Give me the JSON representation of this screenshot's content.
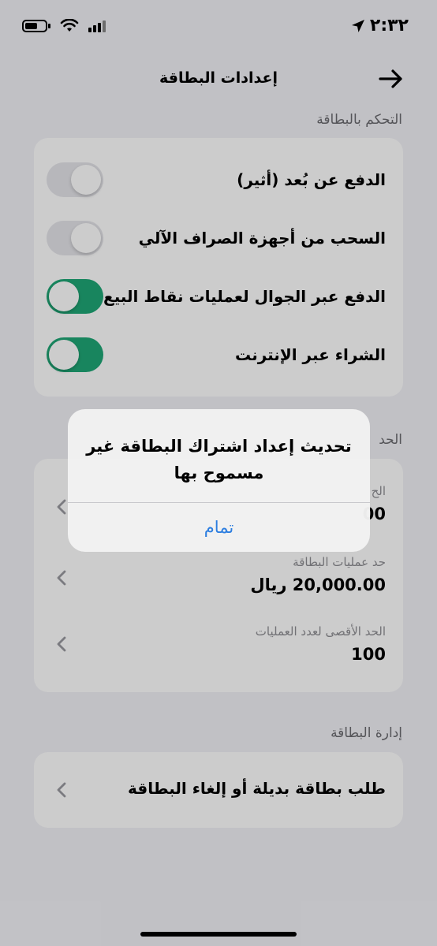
{
  "status_bar": {
    "time": "٢:٣٢"
  },
  "header": {
    "title": "إعدادات البطاقة"
  },
  "card_control": {
    "section_title": "التحكم بالبطاقة",
    "items": [
      {
        "label": "الدفع عن بُعد (أثير)",
        "enabled": false
      },
      {
        "label": "السحب من أجهزة الصراف الآلي",
        "enabled": false
      },
      {
        "label": "الدفع عبر الجوال لعمليات نقاط البيع",
        "enabled": true
      },
      {
        "label": "الشراء عبر الإنترنت",
        "enabled": true
      }
    ]
  },
  "limits": {
    "section_title": "الحد",
    "items": [
      {
        "label": "الح",
        "value": "00"
      },
      {
        "label": "حد عمليات البطاقة",
        "value": "20,000.00 ريال"
      },
      {
        "label": "الحد الأقصى لعدد العمليات",
        "value": "100"
      }
    ]
  },
  "card_management": {
    "section_title": "إدارة البطاقة",
    "item_label": "طلب بطاقة بديلة أو إلغاء البطاقة"
  },
  "alert": {
    "title": "تحديث إعداد اشتراك البطاقة غير مسموح بها",
    "button_label": "تمام"
  },
  "colors": {
    "toggle_on": "#1fa776",
    "toggle_off": "#e5e5ea",
    "link_blue": "#2b7de0"
  }
}
